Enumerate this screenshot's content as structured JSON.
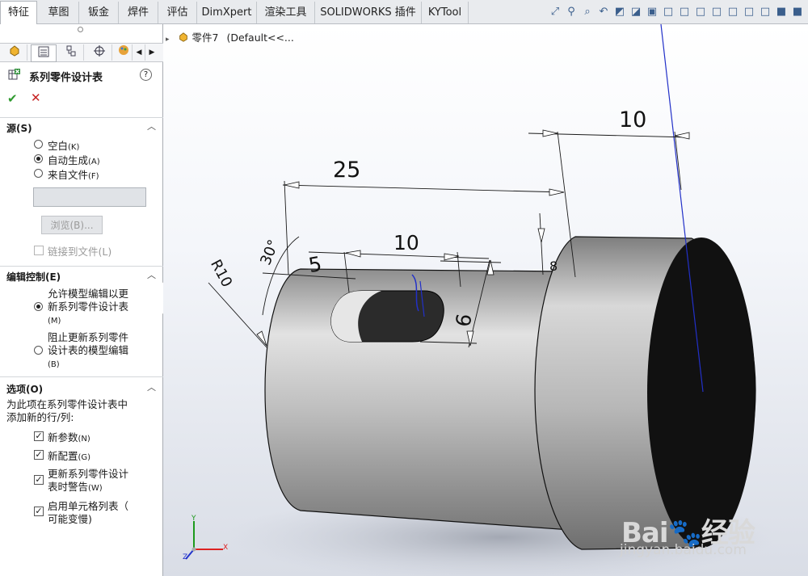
{
  "tabs": [
    "特征",
    "草图",
    "钣金",
    "焊件",
    "评估",
    "DimXpert",
    "渲染工具",
    "SOLIDWORKS 插件",
    "KYTool"
  ],
  "hud_icons": [
    "zoom-fit-icon",
    "zoom-area-icon",
    "zoom-selection-icon",
    "previous-view-icon",
    "section-view-icon",
    "view-orientation-icon",
    "display-style-icon",
    "cube-icon",
    "cube-icon",
    "cube-icon",
    "cube-icon",
    "cube-icon",
    "cube-icon",
    "cube-icon",
    "solid-cube-icon",
    "solid-cube-icon"
  ],
  "manager_tabs": [
    "feature-manager-icon",
    "property-manager-icon",
    "configuration-manager-icon",
    "dimxpert-manager-icon",
    "display-manager-icon"
  ],
  "panel": {
    "title": "系列零件设计表",
    "help": "?",
    "ok": "✔",
    "cancel": "✕",
    "source": {
      "heading": "源(S)",
      "options": [
        {
          "label": "空白",
          "key": "(K)",
          "selected": false
        },
        {
          "label": "自动生成",
          "key": "(A)",
          "selected": true
        },
        {
          "label": "来自文件",
          "key": "(F)",
          "selected": false
        }
      ],
      "file_value": "",
      "browse": "浏览(B)...",
      "link": "链接到文件(L)"
    },
    "edit_control": {
      "heading": "编辑控制(E)",
      "opt1_line1": "允许模型编辑以更",
      "opt1_line2": "新系列零件设计表",
      "opt1_key": "(M)",
      "opt2_line1": "阻止更新系列零件",
      "opt2_line2": "设计表的模型编辑",
      "opt2_key": "(B)"
    },
    "options": {
      "heading": "选项(O)",
      "desc1": "为此项在系列零件设计表中",
      "desc2": "添加新的行/列:",
      "new_params": "新参数",
      "new_params_key": "(N)",
      "new_config": "新配置",
      "new_config_key": "(G)",
      "warn1": "更新系列零件设计",
      "warn2": "表时警告",
      "warn_key": "(W)",
      "cell1": "启用单元格列表（",
      "cell2": "可能变慢)"
    }
  },
  "tree": {
    "arrow": "▸",
    "part": "零件7",
    "config": "(Default<<..."
  },
  "dims": {
    "d25": "25",
    "d10_top": "10",
    "d10_slot": "10",
    "d5": "5",
    "d6": "6",
    "r10": "R10",
    "angle": "30°",
    "small": "8"
  },
  "triad": {
    "x": "X",
    "y": "Y",
    "z": "Z"
  },
  "watermark": {
    "brand": "Bai",
    "brand2": "经验",
    "url": "jingyan.baidu.com"
  }
}
